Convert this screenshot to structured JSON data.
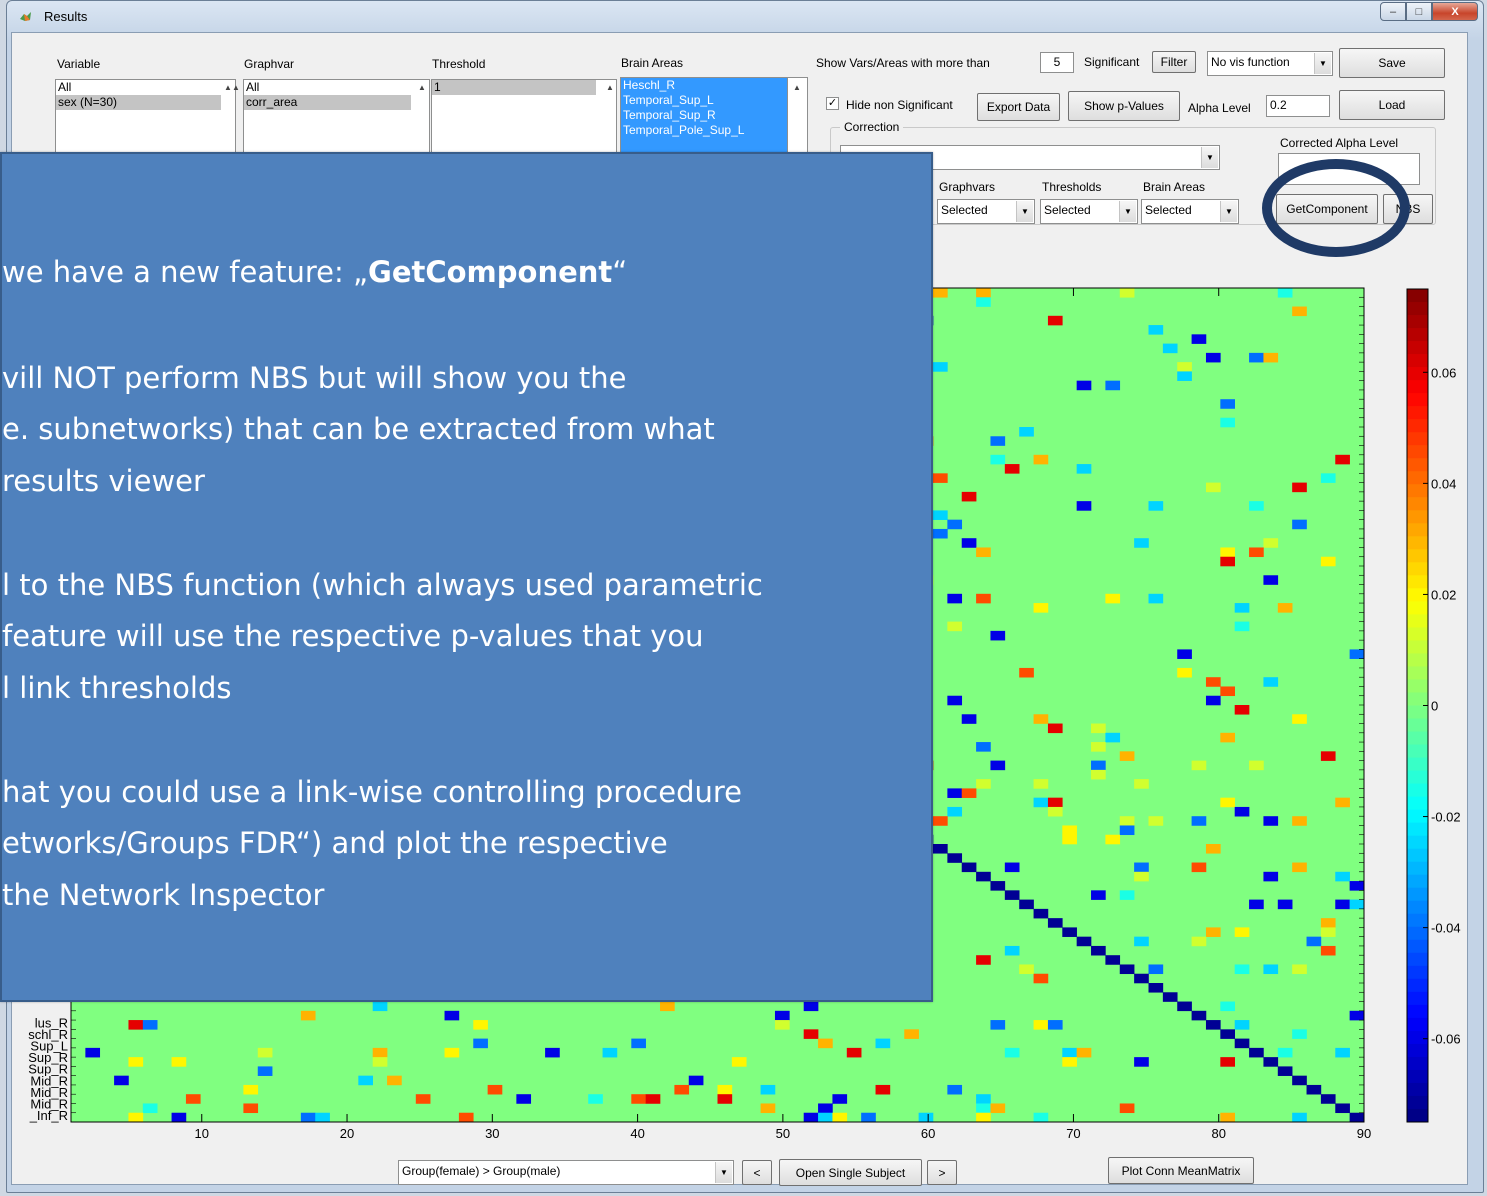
{
  "window": {
    "title": "Results",
    "controls": {
      "minimize": "–",
      "maximize": "□",
      "close": "X"
    }
  },
  "lists": {
    "variable": {
      "header": "Variable",
      "items": [
        "All",
        "sex (N=30)"
      ],
      "selected": 1
    },
    "graphvar": {
      "header": "Graphvar",
      "items": [
        "All",
        "corr_area"
      ],
      "selected": 1
    },
    "threshold": {
      "header": "Threshold",
      "items": [
        "1"
      ],
      "selected": 0
    },
    "brain_areas": {
      "header": "Brain Areas",
      "items": [
        "Heschl_R",
        "Temporal_Sup_L",
        "Temporal_Sup_R",
        "Temporal_Pole_Sup_L"
      ]
    }
  },
  "controls": {
    "show_more_than_label": "Show Vars/Areas with more than",
    "show_more_than_value": "5",
    "significant_label": "Significant",
    "filter_button": "Filter",
    "vis_function": "No vis function",
    "save_button": "Save",
    "load_button": "Load",
    "hide_non_significant": "Hide non Significant",
    "export_data": "Export Data",
    "show_p_values": "Show p-Values",
    "alpha_level_label": "Alpha Level",
    "alpha_level_value": "0.2",
    "correction_label": "Correction",
    "corrected_alpha_label": "Corrected Alpha Level",
    "graphvars_label": "Graphvars",
    "thresholds_label": "Thresholds",
    "brain_areas_label": "Brain Areas",
    "graphvars_value": "Selected",
    "thresholds_value": "Selected",
    "brain_areas_value": "Selected",
    "getcomponent_button": "GetComponent",
    "nbs_button": "NBS"
  },
  "bottom": {
    "contrast": "Group(female)  >  Group(male)",
    "prev_button": "<",
    "open_single_subject": "Open Single Subject",
    "next_button": ">",
    "plot_conn_meanmatrix": "Plot Conn MeanMatrix"
  },
  "chart_data": {
    "type": "heatmap",
    "x_ticks": [
      10,
      20,
      30,
      40,
      50,
      60,
      70,
      80,
      90
    ],
    "xlim": [
      1,
      90
    ],
    "colorbar_ticks": [
      "0.06",
      "0.04",
      "0.02",
      "0",
      "-0.02",
      "-0.04",
      "-0.06"
    ],
    "colorbar_range": [
      -0.075,
      0.075
    ],
    "colormap": "jet",
    "background_value": 0,
    "y_labels_visible": [
      "lus_R",
      "schl_R",
      "Sup_L",
      "Sup_R",
      "Sup_R",
      "Mid_R",
      "Mid_R",
      "Mid_R",
      "_Inf_R"
    ]
  },
  "overlay": {
    "line1a": "we have a new feature: „",
    "line1b": "GetComponent",
    "line1c": "“",
    "line2": "vill NOT perform NBS but will show you the",
    "line3": "e. subnetworks) that can be extracted from what",
    "line4": "results viewer",
    "line5": "l to the NBS function (which always used parametric",
    "line6": "feature will use the respective p-values that you",
    "line7": "l link thresholds",
    "line8": "hat you could use a link-wise controlling procedure",
    "line9": "etworks/Groups FDR“) and plot the respective",
    "line10": "the Network Inspector"
  },
  "colors": {
    "overlay_bg": "#4f81bd",
    "highlight_ring": "#1f3a66",
    "heatmap_bg": "#80ff80"
  }
}
